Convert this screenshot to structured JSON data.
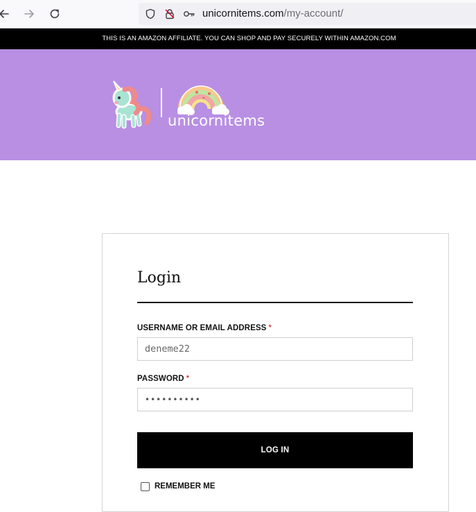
{
  "browser": {
    "url_host": "unicornitems.com",
    "url_path": "/my-account/",
    "icons": {
      "back": "arrow-left-icon",
      "forward": "arrow-right-icon",
      "reload": "reload-icon",
      "tracking": "shield-icon",
      "lock": "lock-icon",
      "permissions": "key-icon"
    }
  },
  "banner": {
    "text": "THIS IS AN AMAZON AFFILIATE. YOU CAN SHOP AND PAY SECURELY WITHIN AMAZON.COM"
  },
  "header": {
    "logo_text": "unicornitems",
    "background": "#b88fe3"
  },
  "login": {
    "title": "Login",
    "username_label": "USERNAME OR EMAIL ADDRESS",
    "required_mark": "*",
    "username_value": "deneme22",
    "password_label": "PASSWORD",
    "password_value": "••••••••••",
    "login_button": "LOG IN",
    "remember_label": "REMEMBER ME"
  }
}
